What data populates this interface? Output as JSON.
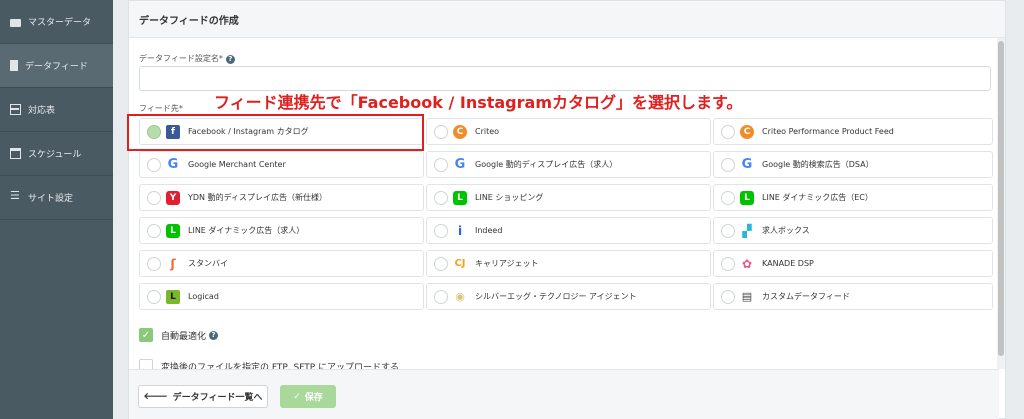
{
  "sidebar": {
    "items": [
      {
        "label": "マスターデータ",
        "icon": "folder-icon"
      },
      {
        "label": "データフィード",
        "icon": "file-icon"
      },
      {
        "label": "対応表",
        "icon": "table-icon"
      },
      {
        "label": "スケジュール",
        "icon": "calendar-icon"
      },
      {
        "label": "サイト設定",
        "icon": "sliders-icon"
      }
    ]
  },
  "panel": {
    "title": "データフィードの作成",
    "name_label": "データフィード設定名*",
    "name_value": "",
    "feed_label": "フィード先*"
  },
  "feeds": [
    {
      "label": "Facebook / Instagram カタログ",
      "logo": "f",
      "selected": true
    },
    {
      "label": "Criteo",
      "logo": "C"
    },
    {
      "label": "Criteo Performance Product Feed",
      "logo": "C"
    },
    {
      "label": "Google Merchant Center",
      "logo": "G"
    },
    {
      "label": "Google 動的ディスプレイ広告（求人）",
      "logo": "G"
    },
    {
      "label": "Google 動的検索広告（DSA）",
      "logo": "G"
    },
    {
      "label": "YDN 動的ディスプレイ広告（新仕様）",
      "logo": "Y"
    },
    {
      "label": "LINE ショッピング",
      "logo": "L"
    },
    {
      "label": "LINE ダイナミック広告（EC）",
      "logo": "L"
    },
    {
      "label": "LINE ダイナミック広告（求人）",
      "logo": "L"
    },
    {
      "label": "Indeed",
      "logo": "i"
    },
    {
      "label": "求人ボックス",
      "logo": "▞"
    },
    {
      "label": "スタンバイ",
      "logo": "ʃ"
    },
    {
      "label": "キャリアジェット",
      "logo": "CJ"
    },
    {
      "label": "KANADE DSP",
      "logo": "✿"
    },
    {
      "label": "Logicad",
      "logo": "L"
    },
    {
      "label": "シルバーエッグ・テクノロジー アイジェント",
      "logo": "◉"
    },
    {
      "label": "カスタムデータフィード",
      "logo": "▤"
    }
  ],
  "options": {
    "auto_optimize_label": "自動最適化",
    "auto_optimize_checked": true,
    "upload_label": "変換後のファイルを指定の FTP, SFTP にアップロードする",
    "upload_checked": false
  },
  "footer": {
    "back_label": "データフィード一覧へ",
    "save_label": "保存"
  },
  "annotation": {
    "text": "フィード連携先で「Facebook / Instagramカタログ」を選択します。"
  },
  "colors": {
    "sidebar_bg": "#4a5a62",
    "annotation_red": "#e0201f",
    "accent_green": "#a8d89a"
  }
}
